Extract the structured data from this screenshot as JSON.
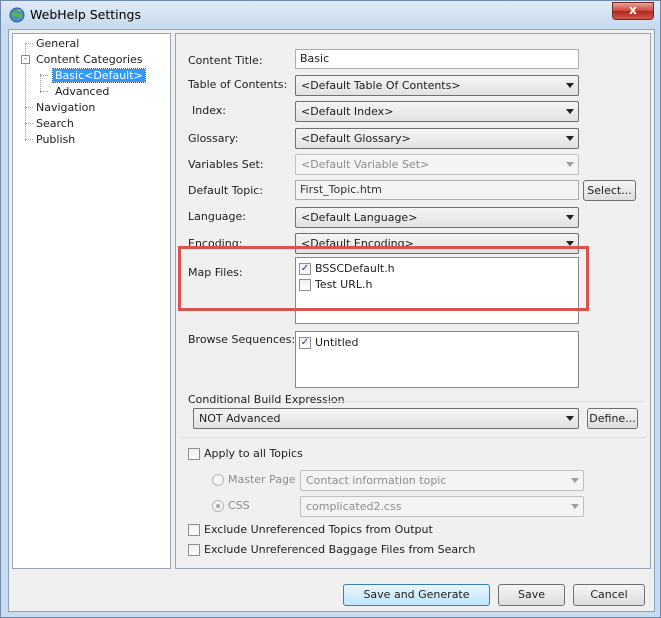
{
  "window": {
    "title": "WebHelp Settings",
    "close_glyph": "x"
  },
  "tree": {
    "items": [
      {
        "label": "General"
      },
      {
        "label": "Content Categories",
        "expander": "-"
      },
      {
        "label": "Basic<Default>",
        "selected": true
      },
      {
        "label": "Advanced"
      },
      {
        "label": "Navigation"
      },
      {
        "label": "Search"
      },
      {
        "label": "Publish"
      }
    ]
  },
  "form": {
    "content_title": {
      "label": "Content Title:",
      "value": "Basic"
    },
    "toc": {
      "label": "Table of Contents:",
      "value": "<Default Table Of Contents>"
    },
    "index": {
      "label": "Index:",
      "value": "<Default Index>"
    },
    "glossary": {
      "label": "Glossary:",
      "value": "<Default Glossary>"
    },
    "variables_set": {
      "label": "Variables Set:",
      "value": "<Default Variable Set>"
    },
    "default_topic": {
      "label": "Default Topic:",
      "value": "First_Topic.htm",
      "button": "Select..."
    },
    "language": {
      "label": "Language:",
      "value": "<Default Language>"
    },
    "encoding": {
      "label": "Encoding:",
      "value": "<Default Encoding>"
    },
    "map_files": {
      "label": "Map Files:",
      "items": [
        {
          "label": "BSSCDefault.h",
          "checked": true
        },
        {
          "label": "Test URL.h",
          "checked": false
        }
      ]
    },
    "browse_sequences": {
      "label": "Browse Sequences:",
      "items": [
        {
          "label": "Untitled",
          "checked": true
        }
      ]
    },
    "conditional_build": {
      "label": "Conditional Build Expression",
      "value": "NOT Advanced",
      "button": "Define..."
    },
    "apply_all_topics": {
      "label": "Apply to all Topics",
      "checked": false
    },
    "master_page": {
      "label": "Master Page",
      "value": "Contact information topic"
    },
    "css": {
      "label": "CSS",
      "value": "complicated2.css"
    },
    "exclude_topics": {
      "label": "Exclude Unreferenced Topics from Output",
      "checked": false
    },
    "exclude_baggage": {
      "label": "Exclude Unreferenced Baggage Files from Search",
      "checked": false
    }
  },
  "buttons": {
    "save_generate": "Save and Generate",
    "save": "Save",
    "cancel": "Cancel"
  },
  "colors": {
    "highlight": "#d9534f",
    "selection": "#3399ff"
  },
  "check_glyph": "✓"
}
